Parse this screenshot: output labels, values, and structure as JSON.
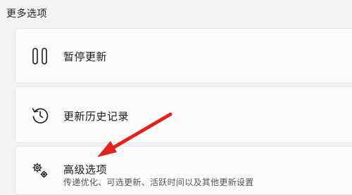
{
  "section": {
    "title": "更多选项"
  },
  "options": {
    "pause": {
      "label": "暂停更新",
      "icon": "pause-icon"
    },
    "history": {
      "label": "更新历史记录",
      "icon": "history-icon"
    },
    "advanced": {
      "label": "高级选项",
      "description": "传递优化、可选更新、活跃时间以及其他更新设置",
      "icon": "gears-icon"
    }
  },
  "annotation": {
    "arrow_color": "#e3211f"
  }
}
